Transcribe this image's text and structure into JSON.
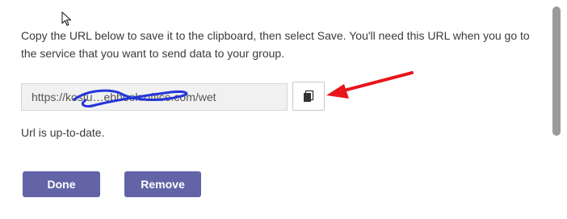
{
  "dialog": {
    "instructions": "Copy the URL below to save it to the clipboard, then select Save. You'll need this URL when you go to the service that you want to send data to your group.",
    "url_value": "https://kostu…ebhook.office.com/wet",
    "copy_icon": "copy-icon",
    "status_text": "Url is up-to-date.",
    "done_label": "Done",
    "remove_label": "Remove"
  },
  "colors": {
    "primary": "#6264a7",
    "annotation_arrow": "#e8141b",
    "annotation_scribble": "#2436d8"
  }
}
